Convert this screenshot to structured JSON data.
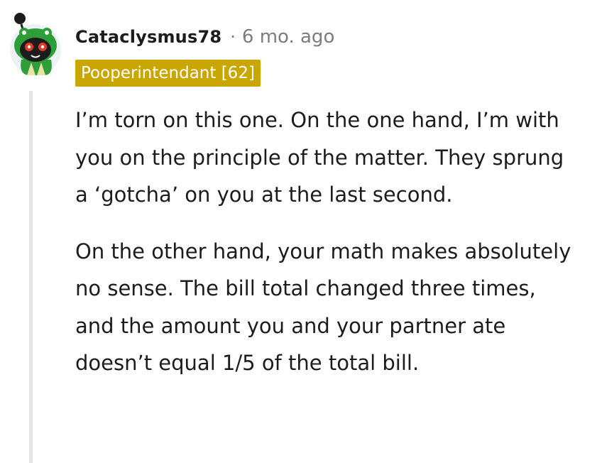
{
  "comment": {
    "username": "Cataclysmus78",
    "separator": "·",
    "timestamp": "6 mo. ago",
    "flair": "Pooperintendant [62]",
    "paragraphs": [
      "I’m torn on this one. On the one hand, I’m with you on the principle of the matter. They sprung a ‘gotcha’ on you at the last second.",
      "On the other hand, your math makes absolutely no sense. The bill total changed three times, and the amount you and your partner ate doesn’t equal 1/5 of the total bill."
    ]
  },
  "colors": {
    "flair_background": "#c9a700",
    "avatar_green": "#2e9e3a",
    "thread_line": "#e5e5e5",
    "meta_gray": "#7c7c7c"
  },
  "icons": {
    "avatar": "snoo-avatar-green-frog-hood"
  }
}
